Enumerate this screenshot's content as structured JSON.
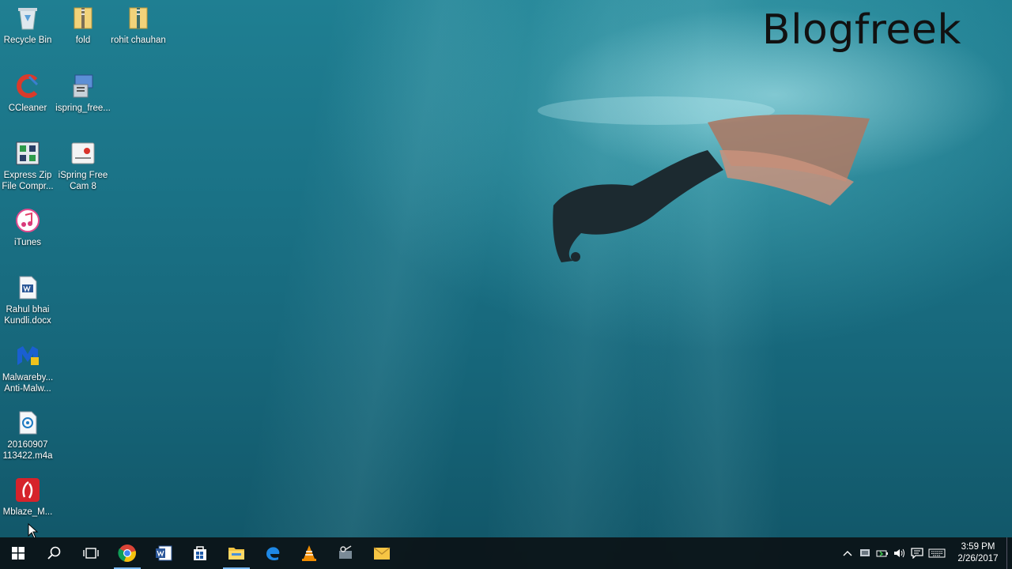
{
  "watermark": "Blogfreek",
  "desktop_icons": [
    {
      "label": "Recycle Bin",
      "icon": "recycle-bin-icon"
    },
    {
      "label": "fold",
      "icon": "zip-folder-icon"
    },
    {
      "label": "rohit chauhan",
      "icon": "zip-folder-icon"
    },
    {
      "label": "CCleaner",
      "icon": "ccleaner-icon"
    },
    {
      "label": "ispring_free...",
      "icon": "installer-icon"
    },
    {
      "label": "Express Zip File Compr...",
      "icon": "express-zip-icon"
    },
    {
      "label": "iSpring Free Cam 8",
      "icon": "ispring-cam-icon"
    },
    {
      "label": "iTunes",
      "icon": "itunes-icon"
    },
    {
      "label": "Rahul bhai Kundli.docx",
      "icon": "docx-file-icon"
    },
    {
      "label": "Malwareby... Anti-Malw...",
      "icon": "malwarebytes-icon"
    },
    {
      "label": "20160907 113422.m4a",
      "icon": "audio-file-icon"
    },
    {
      "label": "Mblaze_M...",
      "icon": "mblaze-icon"
    }
  ],
  "taskbar": {
    "buttons": [
      "start-icon",
      "search-icon",
      "task-view-icon",
      "chrome-icon",
      "word-icon",
      "store-icon",
      "file-explorer-icon",
      "edge-icon",
      "vlc-icon",
      "snipping-tool-icon",
      "mail-icon"
    ],
    "active": [
      "chrome-icon",
      "file-explorer-icon"
    ]
  },
  "tray": {
    "icons": [
      "chevron-up-icon",
      "display-icon",
      "battery-icon",
      "volume-icon",
      "notification-icon",
      "keyboard-icon"
    ],
    "time": "3:59 PM",
    "date": "2/26/2017"
  }
}
